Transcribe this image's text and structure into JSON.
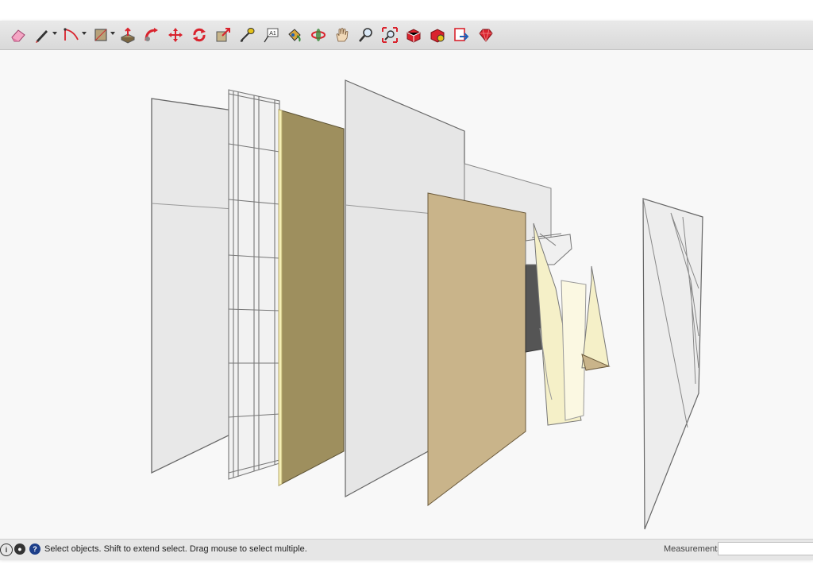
{
  "toolbar": {
    "tools": [
      {
        "name": "eraser-tool",
        "label": "Eraser"
      },
      {
        "name": "pencil-tool",
        "label": "Line"
      },
      {
        "name": "arc-tool",
        "label": "Arc"
      },
      {
        "name": "rectangle-tool",
        "label": "Rectangle"
      },
      {
        "name": "push-pull-tool",
        "label": "Push/Pull"
      },
      {
        "name": "follow-me-tool",
        "label": "Follow Me"
      },
      {
        "name": "move-tool",
        "label": "Move"
      },
      {
        "name": "rotate-tool",
        "label": "Rotate"
      },
      {
        "name": "scale-tool",
        "label": "Scale"
      },
      {
        "name": "tape-measure-tool",
        "label": "Tape Measure"
      },
      {
        "name": "text-tool",
        "label": "Text",
        "glyph": "A1"
      },
      {
        "name": "paint-bucket-tool",
        "label": "Paint Bucket"
      },
      {
        "name": "orbit-tool",
        "label": "Orbit"
      },
      {
        "name": "pan-tool",
        "label": "Pan"
      },
      {
        "name": "zoom-tool",
        "label": "Zoom"
      },
      {
        "name": "zoom-extents-tool",
        "label": "Zoom Extents"
      },
      {
        "name": "warehouse-tool",
        "label": "3D Warehouse"
      },
      {
        "name": "extension-warehouse-tool",
        "label": "Extension Warehouse"
      },
      {
        "name": "send-to-layout-tool",
        "label": "Send to LayOut"
      },
      {
        "name": "ruby-console-tool",
        "label": "Ruby Console"
      }
    ]
  },
  "status": {
    "message": "Select objects. Shift to extend select. Drag mouse to select multiple.",
    "measurements_label": "Measurements",
    "measurements_value": ""
  },
  "colors": {
    "panel_light": "#e3e3e3",
    "panel_olive": "#9e8f5e",
    "panel_tan": "#c9b48a",
    "panel_cream": "#f5f0c8",
    "accent_red": "#d9232d"
  }
}
